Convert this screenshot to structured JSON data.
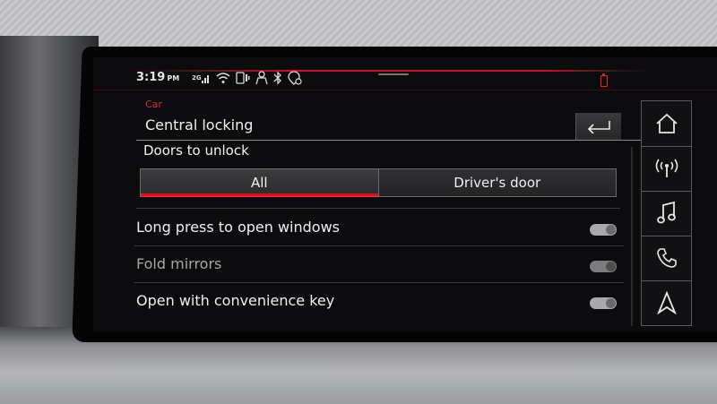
{
  "status_bar": {
    "time": "3:19",
    "ampm": "PM",
    "network_label": "2G",
    "icons": [
      "signal-bars-icon",
      "wifi-icon",
      "phone-link-icon",
      "person-icon",
      "bluetooth-icon",
      "location-shield-icon"
    ],
    "battery_color": "#d82830"
  },
  "header": {
    "category": "Car",
    "title": "Central locking",
    "back_icon": "return-arrow-icon"
  },
  "section": {
    "title": "Doors to unlock",
    "options": [
      "All",
      "Driver's door"
    ],
    "selected": "All"
  },
  "settings": [
    {
      "label": "Long press to open windows",
      "enabled": true,
      "on": true
    },
    {
      "label": "Fold mirrors",
      "enabled": false,
      "on": true
    },
    {
      "label": "Open with convenience key",
      "enabled": true,
      "on": true
    }
  ],
  "rail": {
    "icons": [
      "home-icon",
      "radio-icon",
      "music-note-icon",
      "phone-icon",
      "navigation-arrow-icon"
    ]
  },
  "colors": {
    "accent": "#d3161f",
    "text": "#f0f0f0",
    "background": "#0c0c0e"
  }
}
